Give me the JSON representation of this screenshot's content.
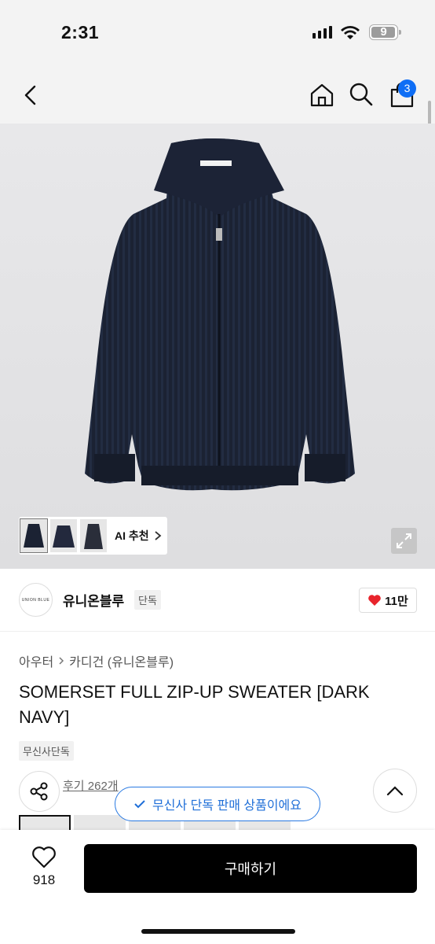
{
  "status": {
    "time": "2:31",
    "battery": "9"
  },
  "nav": {
    "cart_count": "3",
    "icons": [
      "back-icon",
      "home-icon",
      "search-icon",
      "shopping-bag-icon"
    ]
  },
  "gallery": {
    "ai_label": "AI 추천",
    "thumb_count": 3
  },
  "brand": {
    "name": "유니온블루",
    "exclusive_tag": "단독",
    "logo_text": "UNION BLUE",
    "likes": "11만"
  },
  "breadcrumb": {
    "category": "아우터",
    "subcategory": "카디건 (유니온블루)"
  },
  "product": {
    "title": "SOMERSET FULL ZIP-UP SWEATER [DARK NAVY]",
    "badge": "무신사단독"
  },
  "reviews": {
    "label": "후기 262개"
  },
  "toast": {
    "text": "무신사 단독 판매 상품이에요"
  },
  "bottom": {
    "like_count": "918",
    "buy_label": "구매하기"
  },
  "colors": {
    "accent": "#0f6ef5",
    "heart": "#e8242c",
    "toast_border": "#2a7ae2"
  }
}
